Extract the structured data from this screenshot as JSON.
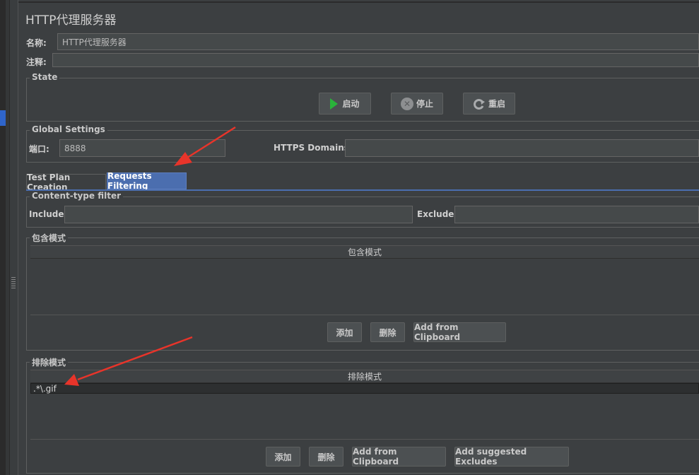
{
  "title": "HTTP代理服务器",
  "name_label": "名称:",
  "name_value": "HTTP代理服务器",
  "comment_label": "注释:",
  "state": {
    "title": "State",
    "start_label": "启动",
    "stop_label": "停止",
    "restart_label": "重启"
  },
  "global": {
    "title": "Global Settings",
    "port_label": "端口:",
    "port_value": "8888",
    "https_label": "HTTPS Domains:"
  },
  "tabs": [
    "Test Plan Creation",
    "Requests Filtering"
  ],
  "content_type": {
    "title": "Content-type filter",
    "include_label": "Include:",
    "exclude_label": "Exclude:"
  },
  "include_patterns": {
    "title": "包含模式",
    "column": "包含模式",
    "add_label": "添加",
    "delete_label": "删除",
    "clipboard_label": "Add from Clipboard"
  },
  "exclude_patterns": {
    "title": "排除模式",
    "column": "排除模式",
    "rows": [
      ".*\\.gif"
    ],
    "add_label": "添加",
    "delete_label": "删除",
    "clipboard_label": "Add from Clipboard",
    "suggested_label": "Add suggested Excludes"
  },
  "colors": {
    "background": "#3c3f41",
    "tab_active": "#4b6eaf",
    "arrow": "#e8342a",
    "play": "#29b33a"
  }
}
